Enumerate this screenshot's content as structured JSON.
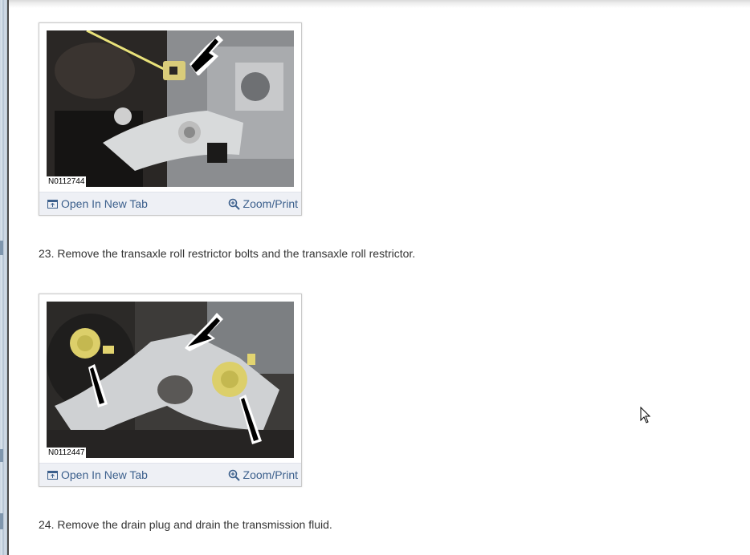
{
  "figures": [
    {
      "code": "N0112744",
      "open_label": "Open In New Tab",
      "zoom_label": "Zoom/Print",
      "open_icon": "open-in-new-tab-icon",
      "zoom_icon": "zoom-magnifier-icon"
    },
    {
      "code": "N0112447",
      "open_label": "Open In New Tab",
      "zoom_label": "Zoom/Print",
      "open_icon": "open-in-new-tab-icon",
      "zoom_icon": "zoom-magnifier-icon"
    }
  ],
  "steps": [
    {
      "text": "23. Remove the transaxle roll restrictor bolts and the transaxle roll restrictor."
    },
    {
      "text": "24. Remove the drain plug and drain the transmission fluid."
    }
  ],
  "colors": {
    "link": "#3b5f8c",
    "body_text": "#333333",
    "figure_bar": "#eef0f5"
  }
}
